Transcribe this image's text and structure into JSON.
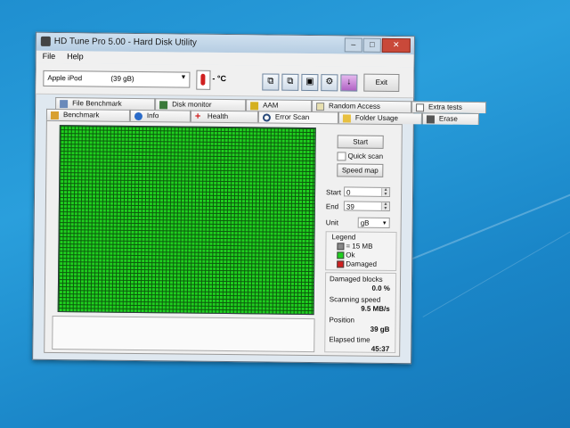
{
  "colors": {
    "grid_ok": "#1fcf1f",
    "desktop": "#1f8fd0",
    "damaged": "#d02020",
    "legend_block": "#888888"
  },
  "window": {
    "title": "HD Tune Pro 5.00 - Hard Disk Utility",
    "min_icon": "minimize-icon",
    "max_icon": "maximize-icon",
    "close_icon": "close-icon"
  },
  "menu": {
    "file": "File",
    "help": "Help"
  },
  "toolbar": {
    "drive_name": "Apple  iPod",
    "drive_size": "(39 gB)",
    "temperature": "- °C",
    "exit_label": "Exit",
    "icons": [
      "copy-icon",
      "copy-all-icon",
      "save-icon",
      "options-icon",
      "download-icon"
    ]
  },
  "tabs_top": [
    {
      "label": "File Benchmark",
      "icon": "file-benchmark-icon"
    },
    {
      "label": "Disk monitor",
      "icon": "disk-monitor-icon"
    },
    {
      "label": "AAM",
      "icon": "speaker-icon"
    },
    {
      "label": "Random Access",
      "icon": "random-access-icon"
    },
    {
      "label": "Extra tests",
      "icon": "extra-tests-icon"
    }
  ],
  "tabs_bottom": [
    {
      "label": "Benchmark",
      "icon": "benchmark-icon"
    },
    {
      "label": "Info",
      "icon": "info-icon"
    },
    {
      "label": "Health",
      "icon": "health-icon"
    },
    {
      "label": "Error Scan",
      "icon": "magnifier-icon",
      "active": true
    },
    {
      "label": "Folder Usage",
      "icon": "folder-icon"
    },
    {
      "label": "Erase",
      "icon": "trash-icon"
    }
  ],
  "scan": {
    "start_button": "Start",
    "quick_scan_label": "Quick scan",
    "quick_scan_checked": false,
    "speed_map_button": "Speed map",
    "start_label": "Start",
    "start_value": "0",
    "end_label": "End",
    "end_value": "39",
    "unit_label": "Unit",
    "unit_value": "gB",
    "legend_title": "Legend",
    "legend_block": "= 15 MB",
    "legend_ok": "Ok",
    "legend_damaged": "Damaged",
    "damaged_blocks_label": "Damaged blocks",
    "damaged_blocks_value": "0.0 %",
    "scanning_speed_label": "Scanning speed",
    "scanning_speed_value": "9.5 MB/s",
    "position_label": "Position",
    "position_value": "39 gB",
    "elapsed_label": "Elapsed time",
    "elapsed_value": "45:37"
  }
}
